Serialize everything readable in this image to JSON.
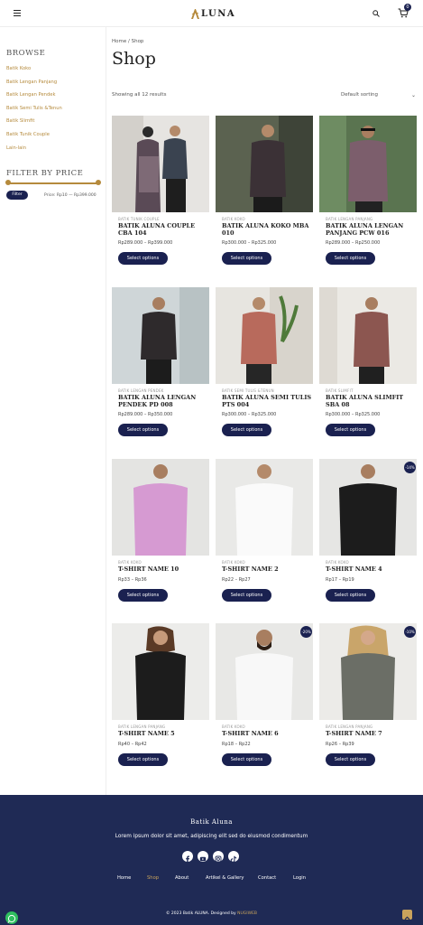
{
  "header": {
    "brand": "LUNA",
    "cart_count": "0"
  },
  "sidebar": {
    "browse_title": "Browse",
    "categories": [
      "Batik Koko",
      "Batik Lengan Panjang",
      "Batik Lengan Pendek",
      "Batik Semi Tulis &Tenun",
      "Batik Slimfit",
      "Batik Tunik Couple",
      "Lain-lain"
    ],
    "filter_title": "Filter by price",
    "filter_button": "Filter",
    "price_range": "Price: Rp10 — Rp399.000"
  },
  "main": {
    "breadcrumb": "Home / Shop",
    "title": "Shop",
    "result_count": "Showing all 12 results",
    "sorting": "Default sorting"
  },
  "products": [
    {
      "category": "Batik Tunik Couple",
      "name": "Batik Aluna Couple CBA 104",
      "price": "Rp289.000 – Rp399.000",
      "button": "Select options",
      "badge": ""
    },
    {
      "category": "Batik Koko",
      "name": "Batik Aluna Koko MBA 010",
      "price": "Rp300.000 – Rp325.000",
      "button": "Select options",
      "badge": ""
    },
    {
      "category": "Batik Lengan Panjang",
      "name": "Batik Aluna Lengan Panjang PCW 016",
      "price": "Rp289.000 – Rp250.000",
      "button": "Select options",
      "badge": ""
    },
    {
      "category": "Batik Lengan Pendek",
      "name": "Batik Aluna Lengan Pendek PD 008",
      "price": "Rp289.000 – Rp350.000",
      "button": "Select options",
      "badge": ""
    },
    {
      "category": "Batik Semi Tulis &Tenun",
      "name": "Batik Aluna Semi Tulis PTS 004",
      "price": "Rp300.000 – Rp325.000",
      "button": "Select options",
      "badge": ""
    },
    {
      "category": "Batik Slimfit",
      "name": "Batik Aluna Slimfit SBA 08",
      "price": "Rp300.000 – Rp325.000",
      "button": "Select options",
      "badge": ""
    },
    {
      "category": "Batik Koko",
      "name": "T-Shirt Name 10",
      "price": "Rp33 – Rp36",
      "button": "Select options",
      "badge": ""
    },
    {
      "category": "Batik Koko",
      "name": "T-Shirt Name 2",
      "price": "Rp22 – Rp27",
      "button": "Select options",
      "badge": ""
    },
    {
      "category": "Batik Koko",
      "name": "T-Shirt Name 4",
      "price": "Rp17 – Rp19",
      "button": "Select options",
      "badge": "-14%"
    },
    {
      "category": "Batik Lengan Panjang",
      "name": "T-Shirt Name 5",
      "price": "Rp40 – Rp42",
      "button": "Select options",
      "badge": ""
    },
    {
      "category": "Batik Koko",
      "name": "T-Shirt Name 6",
      "price": "Rp18 – Rp22",
      "button": "Select options",
      "badge": "-20%"
    },
    {
      "category": "Batik Lengan Panjang",
      "name": "T-Shirt Name 7",
      "price": "Rp26 – Rp39",
      "button": "Select options",
      "badge": "-10%"
    }
  ],
  "footer": {
    "brand": "Batik Aluna",
    "description": "Lorem ipsum dolor sit amet, adipiscing elit sed do eiusmod condimentum",
    "nav": [
      "Home",
      "Shop",
      "About",
      "Artikel & Gallery",
      "Contact",
      "Login"
    ],
    "copyright": "© 2023 Batik ALUNA. Designed by",
    "designer": "NUGIWEB"
  },
  "colors": {
    "accent": "#b58a3c",
    "navy": "#1a2150",
    "footer_bg": "#1f2a55"
  }
}
